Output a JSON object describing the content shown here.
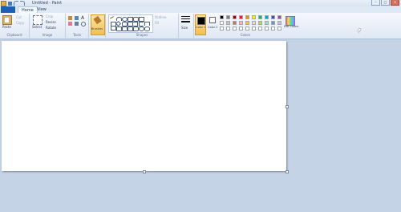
{
  "window": {
    "title": "Untitled - Paint",
    "buttons": [
      "–",
      "□",
      "✕"
    ]
  },
  "tabs": {
    "file": "",
    "home": "Home",
    "view": "View"
  },
  "ribbon": {
    "clipboard": {
      "label": "Clipboard",
      "paste": "Paste",
      "cut": "Cut",
      "copy": "Copy"
    },
    "image": {
      "label": "Image",
      "select": "Select",
      "crop": "Crop",
      "resize": "Resize",
      "rotate": "Rotate"
    },
    "tools": {
      "label": "Tools"
    },
    "brushes": {
      "label": "Brushes"
    },
    "shapes": {
      "label": "Shapes",
      "outline": "Outline",
      "fill": "Fill"
    },
    "size": {
      "label": "Size"
    },
    "colors": {
      "label": "Colors",
      "color1": "Color 1",
      "color2": "Color 2",
      "edit": "Edit colors",
      "color1_value": "#000000",
      "color2_value": "#ffffff",
      "palette_row1": [
        "#000000",
        "#7f7f7f",
        "#880015",
        "#ed1c24",
        "#ff7f27",
        "#fff200",
        "#22b14c",
        "#00a2e8",
        "#3f48cc",
        "#a349a4"
      ],
      "palette_row2": [
        "#ffffff",
        "#c3c3c3",
        "#b97a57",
        "#ffaec9",
        "#ffc90e",
        "#efe4b0",
        "#b5e61d",
        "#99d9ea",
        "#7092be",
        "#c8bfe7"
      ],
      "palette_row3": [
        "#ffffff",
        "#ffffff",
        "#ffffff",
        "#ffffff",
        "#ffffff",
        "#ffffff",
        "#ffffff",
        "#ffffff",
        "#ffffff",
        "#ffffff"
      ]
    }
  }
}
